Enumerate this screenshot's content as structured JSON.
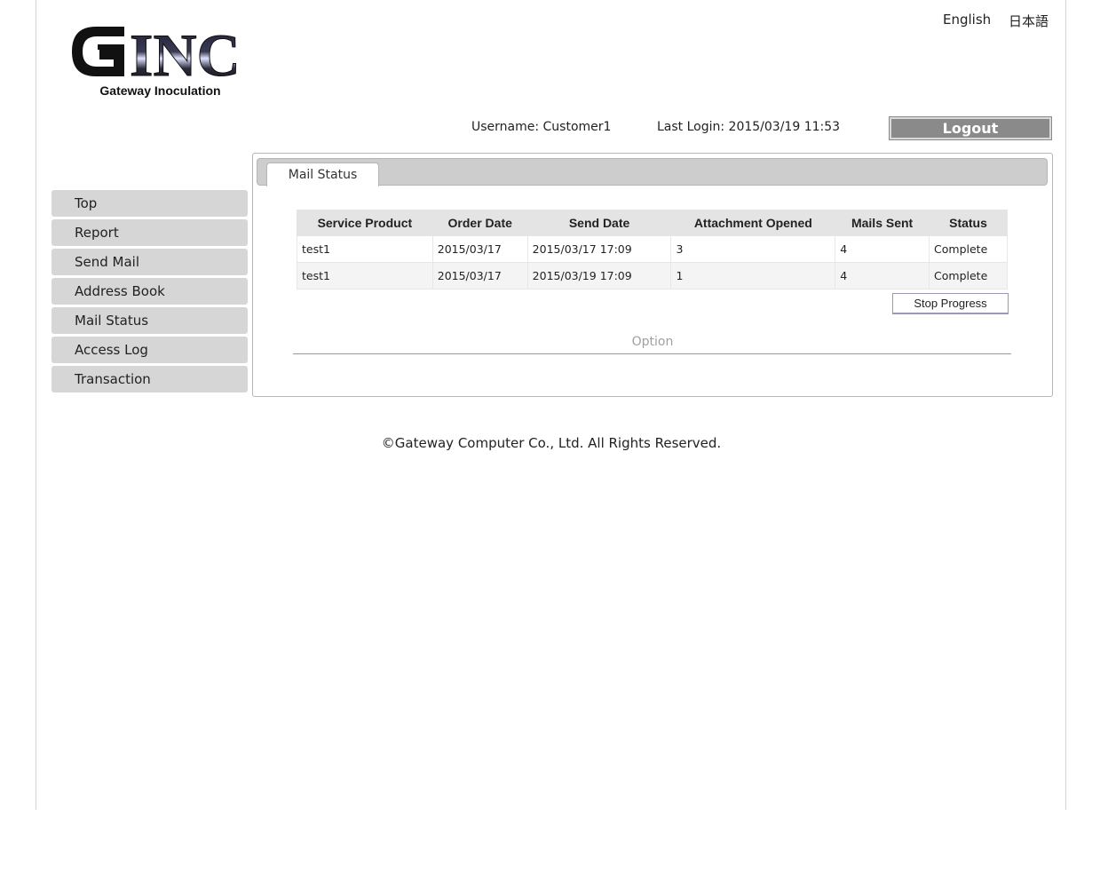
{
  "brand": {
    "logo_text": "INC",
    "logo_subtitle": "Gateway Inoculation"
  },
  "languages": {
    "english": "English",
    "japanese": "日本語"
  },
  "user": {
    "username": "Username: Customer1",
    "last_login": "Last Login: 2015/03/19 11:53",
    "logout_label": "Logout"
  },
  "sidebar": {
    "items": [
      {
        "label": "Top"
      },
      {
        "label": "Report"
      },
      {
        "label": "Send Mail"
      },
      {
        "label": "Address Book"
      },
      {
        "label": "Mail Status"
      },
      {
        "label": "Access Log"
      },
      {
        "label": "Transaction"
      }
    ]
  },
  "main": {
    "tab_label": "Mail Status",
    "table": {
      "headers": [
        "Service Product",
        "Order Date",
        "Send Date",
        "Attachment Opened",
        "Mails Sent",
        "Status"
      ],
      "rows": [
        [
          "test1",
          "2015/03/17",
          "2015/03/17 17:09",
          "3",
          "4",
          "Complete"
        ],
        [
          "test1",
          "2015/03/17",
          "2015/03/19 17:09",
          "1",
          "4",
          "Complete"
        ]
      ]
    },
    "stop_button_label": "Stop Progress",
    "option_label": "Option"
  },
  "footer": {
    "copyright": "©Gateway Computer Co., Ltd. All Rights Reserved."
  },
  "colors": {
    "nav_bg": "#d6d6d6",
    "logout_bg": "#8a8a8a",
    "tabbar_bg": "#cdcdcd",
    "header_bg": "#e4e4e4"
  }
}
